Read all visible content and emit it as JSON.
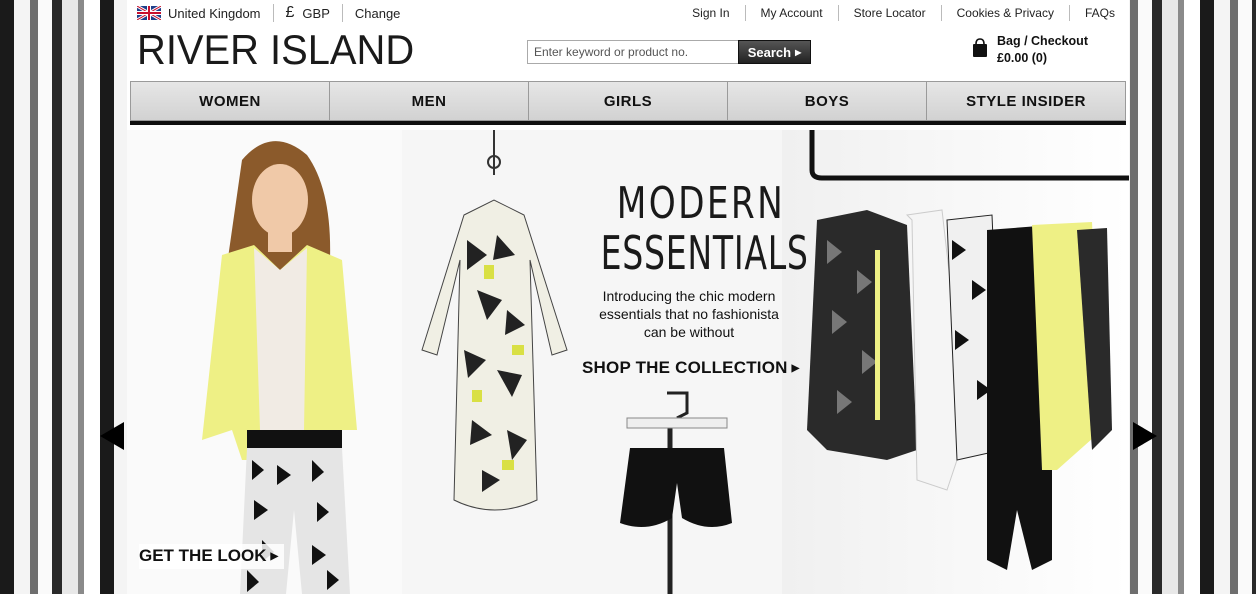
{
  "utility": {
    "region": "United Kingdom",
    "currency_symbol": "£",
    "currency": "GBP",
    "change": "Change",
    "links": [
      "Sign In",
      "My Account",
      "Store Locator",
      "Cookies & Privacy",
      "FAQs"
    ]
  },
  "brand": {
    "logo": "RIVER ISLAND"
  },
  "search": {
    "placeholder": "Enter keyword or product no.",
    "button": "Search"
  },
  "bag": {
    "label": "Bag / Checkout",
    "total": "£0.00 (0)"
  },
  "nav": {
    "items": [
      "WOMEN",
      "MEN",
      "GIRLS",
      "BOYS",
      "STYLE INSIDER"
    ]
  },
  "hero": {
    "headline_line1": "MODERN",
    "headline_line2": "ESSENTIALS",
    "intro": "Introducing the chic modern essentials that no fashionista can be without",
    "cta_shop": "SHOP THE COLLECTION",
    "cta_look": "GET THE LOOK"
  },
  "colors": {
    "accent_yellow": "#f2f27a",
    "text": "#111111",
    "nav_bg": "#dcdcdc"
  }
}
